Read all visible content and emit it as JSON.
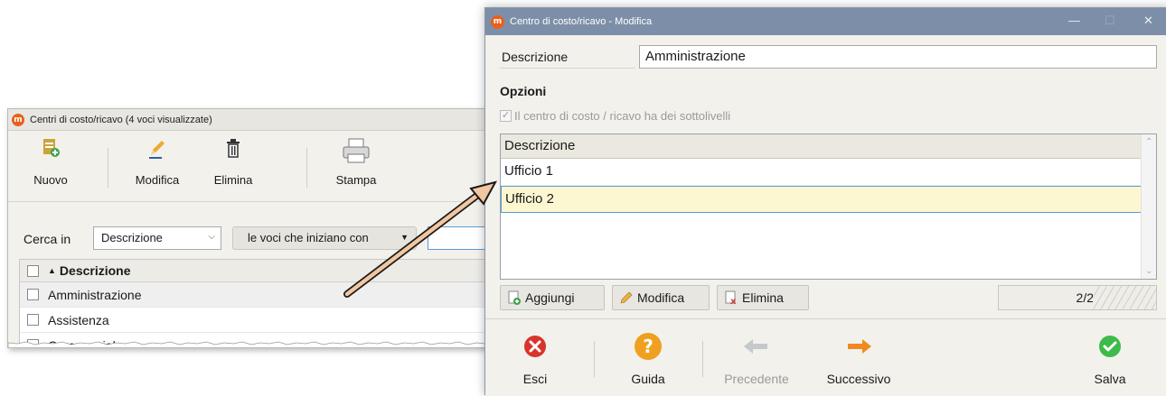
{
  "bg_window": {
    "title": "Centri di costo/ricavo (4 voci visualizzate)",
    "toolbar": {
      "nuovo": "Nuovo",
      "modifica": "Modifica",
      "elimina": "Elimina",
      "stampa": "Stampa"
    },
    "search": {
      "label": "Cerca in",
      "field": "Descrizione",
      "mode": "le voci che iniziano con"
    },
    "grid": {
      "header": "Descrizione",
      "rows": [
        "Amministrazione",
        "Assistenza",
        "Commerciale"
      ]
    }
  },
  "modal": {
    "title": "Centro di costo/ricavo - Modifica",
    "controls": {
      "minimize": "—",
      "maximize": "☐",
      "close": "✕"
    },
    "descrizione_label": "Descrizione",
    "descrizione_value": "Amministrazione",
    "opzioni_label": "Opzioni",
    "sublevel_checkbox": "Il centro di costo / ricavo ha dei sottolivelli",
    "sub_grid": {
      "header": "Descrizione",
      "rows": [
        "Ufficio 1",
        "Ufficio 2"
      ]
    },
    "sub_buttons": {
      "aggiungi": "Aggiungi",
      "modifica": "Modifica",
      "elimina": "Elimina"
    },
    "counter": "2/2",
    "footer": {
      "esci": "Esci",
      "guida": "Guida",
      "precedente": "Precedente",
      "successivo": "Successivo",
      "salva": "Salva"
    }
  },
  "colors": {
    "modal_titlebar": "#7d8fa8",
    "selected_row": "#fdf7d1",
    "app_logo": "#e8601c",
    "annotation_arrow": "#f2c6a0"
  }
}
